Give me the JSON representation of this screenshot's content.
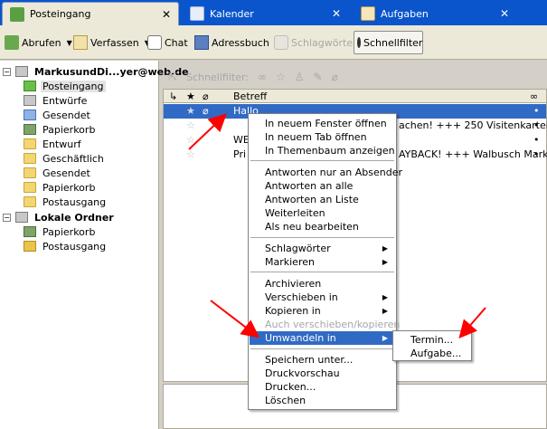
{
  "tabs": [
    {
      "label": "Posteingang",
      "icon": "inbox-icon",
      "active": true
    },
    {
      "label": "Kalender",
      "icon": "calendar-icon",
      "active": false
    },
    {
      "label": "Aufgaben",
      "icon": "tasks-icon",
      "active": false
    }
  ],
  "toolbar": {
    "get_label": "Abrufen",
    "write_label": "Verfassen",
    "chat_label": "Chat",
    "addressbook_label": "Adressbuch",
    "tags_label": "Schlagwörter",
    "quickfilter_label": "Schnellfilter"
  },
  "folders": {
    "account1": "MarkusundDi...yer@web.de",
    "account1_items": [
      "Posteingang",
      "Entwürfe",
      "Gesendet",
      "Papierkorb",
      "Entwurf",
      "Geschäftlich",
      "Gesendet",
      "Papierkorb",
      "Postausgang"
    ],
    "account2": "Lokale Ordner",
    "account2_items": [
      "Papierkorb",
      "Postausgang"
    ]
  },
  "quickfilter": {
    "label": "Schnellfilter:"
  },
  "threadpane": {
    "subject_header": "Betreff",
    "rows": [
      {
        "subject": "Hallo",
        "selected": true
      },
      {
        "subject": "",
        "tail": "achen! +++ 250 Visitenkarten ...",
        "selected": false
      },
      {
        "subject": "WE",
        "tail": "",
        "selected": false
      },
      {
        "subject": "Pri",
        "tail": "AYBACK! +++ Walbusch Mark...",
        "selected": false
      }
    ]
  },
  "context_menu": {
    "items": [
      "In neuem Fenster öffnen",
      "In neuem Tab öffnen",
      "In Themenbaum anzeigen",
      "Antworten nur an Absender",
      "Antworten an alle",
      "Antworten an Liste",
      "Weiterleiten",
      "Als neu bearbeiten",
      "Schlagwörter",
      "Markieren",
      "Archivieren",
      "Verschieben in",
      "Kopieren in",
      "Auch verschieben/kopieren",
      "Umwandeln in",
      "Speichern unter...",
      "Druckvorschau",
      "Drucken...",
      "Löschen"
    ],
    "highlighted": "Umwandeln in"
  },
  "submenu": {
    "items": [
      "Termin...",
      "Aufgabe..."
    ]
  },
  "colors": {
    "tabbar": "#0a55cc",
    "selection": "#316ac5",
    "annotation_arrow": "#ff0000"
  }
}
